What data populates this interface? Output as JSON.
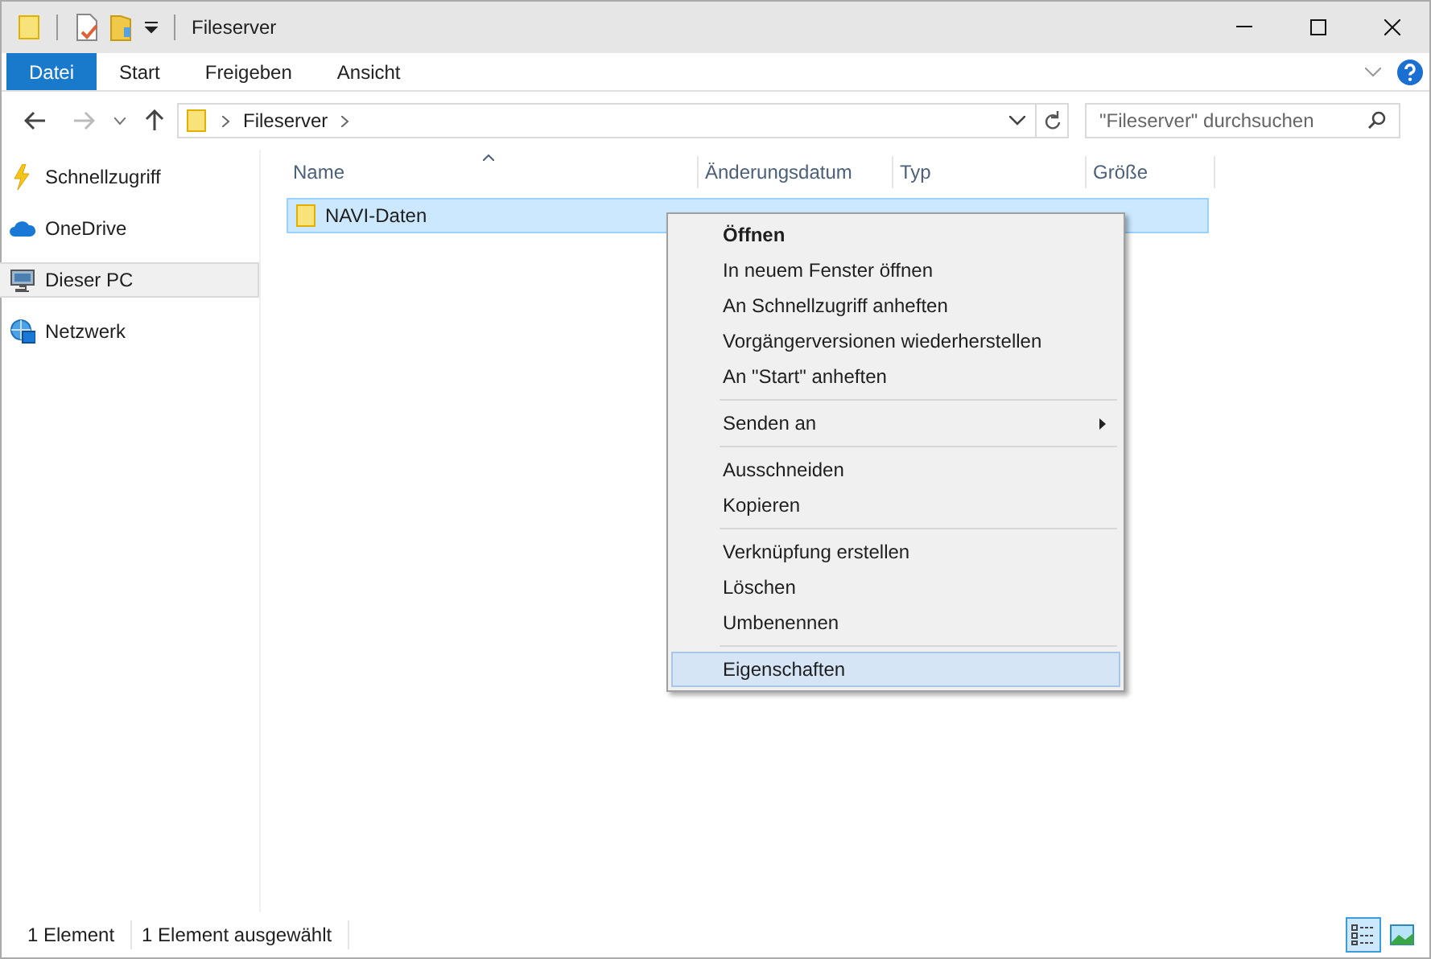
{
  "window": {
    "title": "Fileserver"
  },
  "ribbon_tabs": [
    {
      "label": "Datei",
      "selected": true
    },
    {
      "label": "Start",
      "selected": false
    },
    {
      "label": "Freigeben",
      "selected": false
    },
    {
      "label": "Ansicht",
      "selected": false
    }
  ],
  "address_bar": {
    "path": "Fileserver"
  },
  "search": {
    "placeholder": "\"Fileserver\" durchsuchen"
  },
  "sidebar": {
    "items": [
      {
        "label": "Schnellzugriff",
        "kind": "quick",
        "selected": false
      },
      {
        "label": "OneDrive",
        "kind": "cloud",
        "selected": false
      },
      {
        "label": "Dieser PC",
        "kind": "pc",
        "selected": true
      },
      {
        "label": "Netzwerk",
        "kind": "network",
        "selected": false
      }
    ]
  },
  "table": {
    "columns": [
      "Name",
      "Änderungsdatum",
      "Typ",
      "Größe"
    ],
    "rows": [
      {
        "name": "NAVI-Daten",
        "selected": true
      }
    ]
  },
  "context_menu": {
    "groups": [
      [
        {
          "label": "Öffnen",
          "default": true,
          "submenu": false,
          "selected": false
        },
        {
          "label": "In neuem Fenster öffnen",
          "default": false,
          "submenu": false,
          "selected": false
        },
        {
          "label": "An Schnellzugriff anheften",
          "default": false,
          "submenu": false,
          "selected": false
        },
        {
          "label": "Vorgängerversionen wiederherstellen",
          "default": false,
          "submenu": false,
          "selected": false
        },
        {
          "label": "An \"Start\" anheften",
          "default": false,
          "submenu": false,
          "selected": false
        }
      ],
      [
        {
          "label": "Senden an",
          "default": false,
          "submenu": true,
          "selected": false
        }
      ],
      [
        {
          "label": "Ausschneiden",
          "default": false,
          "submenu": false,
          "selected": false
        },
        {
          "label": "Kopieren",
          "default": false,
          "submenu": false,
          "selected": false
        }
      ],
      [
        {
          "label": "Verknüpfung erstellen",
          "default": false,
          "submenu": false,
          "selected": false
        },
        {
          "label": "Löschen",
          "default": false,
          "submenu": false,
          "selected": false
        },
        {
          "label": "Umbenennen",
          "default": false,
          "submenu": false,
          "selected": false
        }
      ],
      [
        {
          "label": "Eigenschaften",
          "default": false,
          "submenu": false,
          "selected": true
        }
      ]
    ]
  },
  "status_bar": {
    "items": [
      "1 Element",
      "1 Element ausgewählt"
    ],
    "views": [
      {
        "kind": "details",
        "selected": true
      },
      {
        "kind": "thumbnails",
        "selected": false
      }
    ]
  }
}
